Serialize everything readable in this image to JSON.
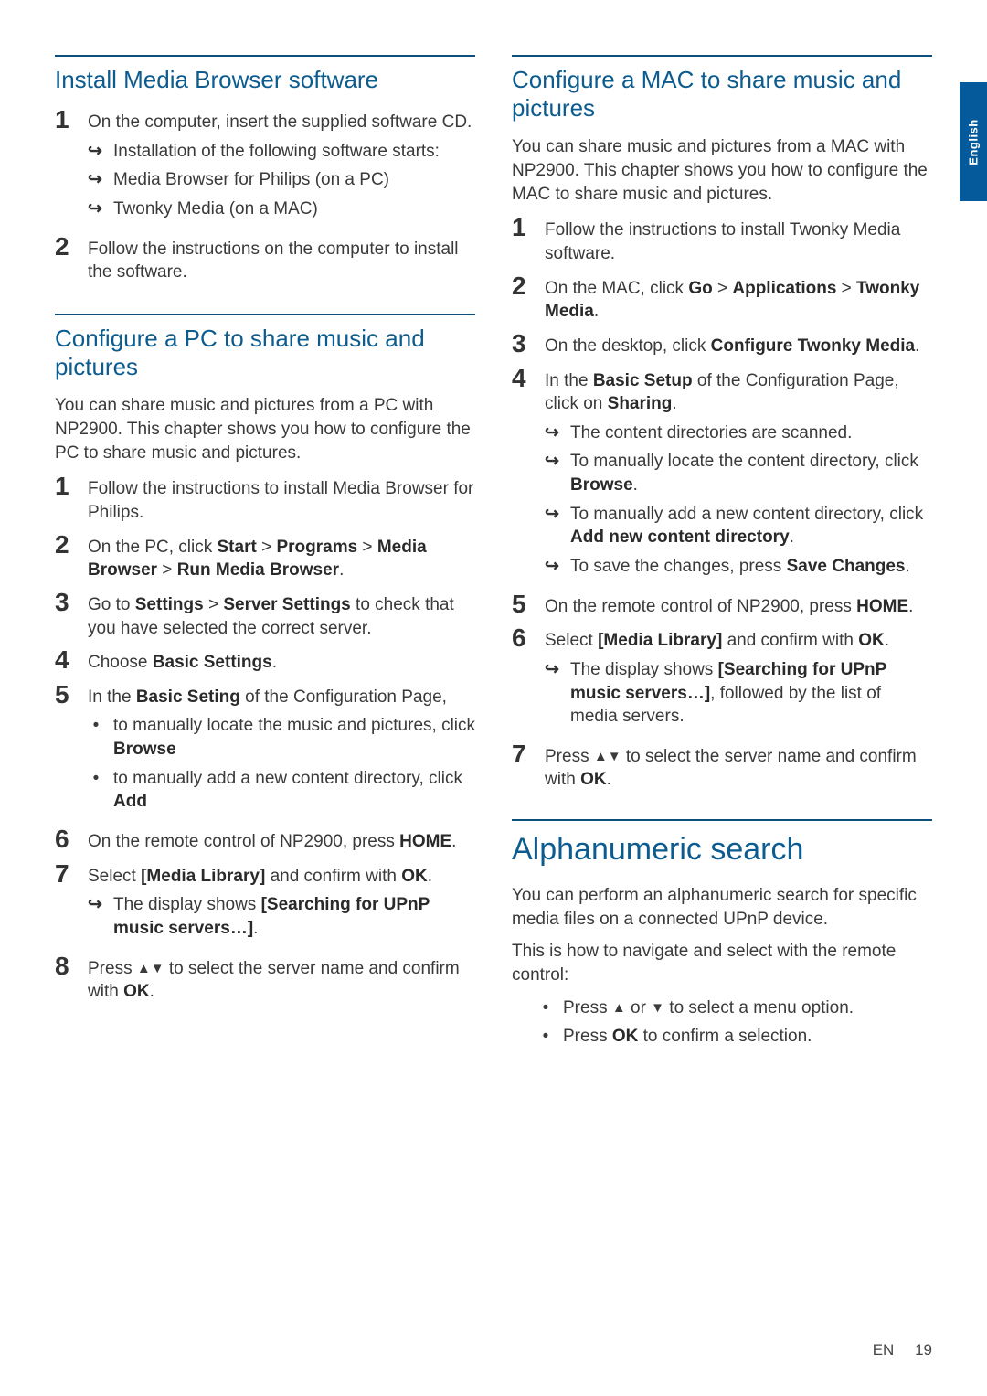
{
  "sidetab": "English",
  "footer": {
    "lang": "EN",
    "page": "19"
  },
  "left": {
    "sec1": {
      "title": "Install Media Browser software",
      "s1": "On the computer, insert the supplied software CD.",
      "s1a": "Installation of the following software starts:",
      "s1b": "Media Browser for Philips (on a PC)",
      "s1c": "Twonky Media (on a MAC)",
      "s2": "Follow the instructions on the computer to install the software."
    },
    "sec2": {
      "title": "Configure a PC to share music and pictures",
      "intro": "You can share music and pictures from a PC with NP2900. This chapter shows you how to configure the PC to share music and pictures.",
      "s1": "Follow the instructions to install Media Browser for Philips.",
      "s2a": "On the PC, click ",
      "s2b": "Start",
      "s2c": " > ",
      "s2d": "Programs",
      "s2e": " > ",
      "s2f": "Media Browser",
      "s2g": " > ",
      "s2h": "Run Media Browser",
      "s2i": ".",
      "s3a": "Go to ",
      "s3b": "Settings",
      "s3c": " > ",
      "s3d": "Server Settings",
      "s3e": " to check that you have selected the correct server.",
      "s4a": "Choose ",
      "s4b": "Basic Settings",
      "s4c": ".",
      "s5a": "In the ",
      "s5b": "Basic Seting",
      "s5c": " of the Configuration Page,",
      "s5d1": "to manually locate the music and pictures, click ",
      "s5d1b": "Browse",
      "s5d2": "to manually add a new content directory, click ",
      "s5d2b": "Add",
      "s6a": "On the remote control of NP2900, press ",
      "s6b": "HOME",
      "s6c": ".",
      "s7a": "Select ",
      "s7b": "[Media Library]",
      "s7c": " and confirm with ",
      "s7d": "OK",
      "s7e": ".",
      "s7sub1a": "The display shows ",
      "s7sub1b": "[Searching for UPnP music servers…]",
      "s7sub1c": ".",
      "s8a": "Press ",
      "s8b": " to select the server name and confirm with ",
      "s8c": "OK",
      "s8d": "."
    }
  },
  "right": {
    "sec1": {
      "title": "Configure a MAC to share music and pictures",
      "intro": "You can share music and pictures from a MAC with NP2900. This chapter shows you how to configure the MAC to share music and pictures.",
      "s1": "Follow the instructions to install Twonky Media software.",
      "s2a": "On the MAC, click ",
      "s2b": "Go",
      "s2c": " > ",
      "s2d": "Applications",
      "s2e": " > ",
      "s2f": "Twonky Media",
      "s2g": ".",
      "s3a": "On the desktop, click ",
      "s3b": "Configure Twonky Media",
      "s3c": ".",
      "s4a": "In the ",
      "s4b": "Basic Setup",
      "s4c": " of the Configuration Page, click on ",
      "s4d": "Sharing",
      "s4e": ".",
      "s4s1": "The content directories are scanned.",
      "s4s2a": "To manually locate the content directory, click ",
      "s4s2b": "Browse",
      "s4s2c": ".",
      "s4s3a": "To manually add a new content directory, click ",
      "s4s3b": "Add new content directory",
      "s4s3c": ".",
      "s4s4a": "To save the changes, press ",
      "s4s4b": "Save Changes",
      "s4s4c": ".",
      "s5a": "On the remote control of NP2900, press ",
      "s5b": "HOME",
      "s5c": ".",
      "s6a": "Select ",
      "s6b": "[Media Library]",
      "s6c": " and confirm with ",
      "s6d": "OK",
      "s6e": ".",
      "s6s1a": "The display shows ",
      "s6s1b": "[Searching for UPnP music servers…]",
      "s6s1c": ", followed by the list of media servers.",
      "s7a": "Press ",
      "s7b": " to select the server name and confirm with ",
      "s7c": "OK",
      "s7d": "."
    },
    "sec2": {
      "title": "Alphanumeric search",
      "p1": "You can perform an alphanumeric search for specific media files on a connected UPnP device.",
      "p2": "This is how to navigate and select with the remote control:",
      "b1a": "Press ",
      "b1b": " or ",
      "b1c": " to select a menu option.",
      "b2a": "Press ",
      "b2b": "OK",
      "b2c": " to confirm a selection."
    }
  }
}
